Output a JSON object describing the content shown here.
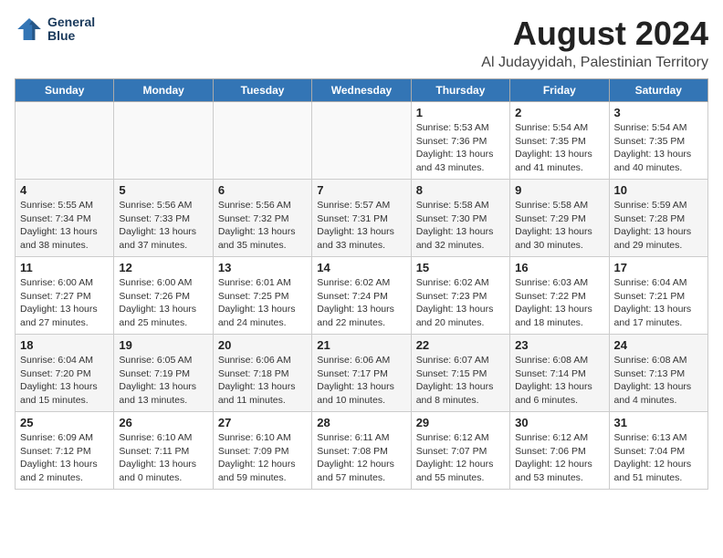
{
  "header": {
    "logo_line1": "General",
    "logo_line2": "Blue",
    "main_title": "August 2024",
    "subtitle": "Al Judayyidah, Palestinian Territory"
  },
  "calendar": {
    "weekdays": [
      "Sunday",
      "Monday",
      "Tuesday",
      "Wednesday",
      "Thursday",
      "Friday",
      "Saturday"
    ],
    "weeks": [
      [
        {
          "day": "",
          "info": ""
        },
        {
          "day": "",
          "info": ""
        },
        {
          "day": "",
          "info": ""
        },
        {
          "day": "",
          "info": ""
        },
        {
          "day": "1",
          "info": "Sunrise: 5:53 AM\nSunset: 7:36 PM\nDaylight: 13 hours\nand 43 minutes."
        },
        {
          "day": "2",
          "info": "Sunrise: 5:54 AM\nSunset: 7:35 PM\nDaylight: 13 hours\nand 41 minutes."
        },
        {
          "day": "3",
          "info": "Sunrise: 5:54 AM\nSunset: 7:35 PM\nDaylight: 13 hours\nand 40 minutes."
        }
      ],
      [
        {
          "day": "4",
          "info": "Sunrise: 5:55 AM\nSunset: 7:34 PM\nDaylight: 13 hours\nand 38 minutes."
        },
        {
          "day": "5",
          "info": "Sunrise: 5:56 AM\nSunset: 7:33 PM\nDaylight: 13 hours\nand 37 minutes."
        },
        {
          "day": "6",
          "info": "Sunrise: 5:56 AM\nSunset: 7:32 PM\nDaylight: 13 hours\nand 35 minutes."
        },
        {
          "day": "7",
          "info": "Sunrise: 5:57 AM\nSunset: 7:31 PM\nDaylight: 13 hours\nand 33 minutes."
        },
        {
          "day": "8",
          "info": "Sunrise: 5:58 AM\nSunset: 7:30 PM\nDaylight: 13 hours\nand 32 minutes."
        },
        {
          "day": "9",
          "info": "Sunrise: 5:58 AM\nSunset: 7:29 PM\nDaylight: 13 hours\nand 30 minutes."
        },
        {
          "day": "10",
          "info": "Sunrise: 5:59 AM\nSunset: 7:28 PM\nDaylight: 13 hours\nand 29 minutes."
        }
      ],
      [
        {
          "day": "11",
          "info": "Sunrise: 6:00 AM\nSunset: 7:27 PM\nDaylight: 13 hours\nand 27 minutes."
        },
        {
          "day": "12",
          "info": "Sunrise: 6:00 AM\nSunset: 7:26 PM\nDaylight: 13 hours\nand 25 minutes."
        },
        {
          "day": "13",
          "info": "Sunrise: 6:01 AM\nSunset: 7:25 PM\nDaylight: 13 hours\nand 24 minutes."
        },
        {
          "day": "14",
          "info": "Sunrise: 6:02 AM\nSunset: 7:24 PM\nDaylight: 13 hours\nand 22 minutes."
        },
        {
          "day": "15",
          "info": "Sunrise: 6:02 AM\nSunset: 7:23 PM\nDaylight: 13 hours\nand 20 minutes."
        },
        {
          "day": "16",
          "info": "Sunrise: 6:03 AM\nSunset: 7:22 PM\nDaylight: 13 hours\nand 18 minutes."
        },
        {
          "day": "17",
          "info": "Sunrise: 6:04 AM\nSunset: 7:21 PM\nDaylight: 13 hours\nand 17 minutes."
        }
      ],
      [
        {
          "day": "18",
          "info": "Sunrise: 6:04 AM\nSunset: 7:20 PM\nDaylight: 13 hours\nand 15 minutes."
        },
        {
          "day": "19",
          "info": "Sunrise: 6:05 AM\nSunset: 7:19 PM\nDaylight: 13 hours\nand 13 minutes."
        },
        {
          "day": "20",
          "info": "Sunrise: 6:06 AM\nSunset: 7:18 PM\nDaylight: 13 hours\nand 11 minutes."
        },
        {
          "day": "21",
          "info": "Sunrise: 6:06 AM\nSunset: 7:17 PM\nDaylight: 13 hours\nand 10 minutes."
        },
        {
          "day": "22",
          "info": "Sunrise: 6:07 AM\nSunset: 7:15 PM\nDaylight: 13 hours\nand 8 minutes."
        },
        {
          "day": "23",
          "info": "Sunrise: 6:08 AM\nSunset: 7:14 PM\nDaylight: 13 hours\nand 6 minutes."
        },
        {
          "day": "24",
          "info": "Sunrise: 6:08 AM\nSunset: 7:13 PM\nDaylight: 13 hours\nand 4 minutes."
        }
      ],
      [
        {
          "day": "25",
          "info": "Sunrise: 6:09 AM\nSunset: 7:12 PM\nDaylight: 13 hours\nand 2 minutes."
        },
        {
          "day": "26",
          "info": "Sunrise: 6:10 AM\nSunset: 7:11 PM\nDaylight: 13 hours\nand 0 minutes."
        },
        {
          "day": "27",
          "info": "Sunrise: 6:10 AM\nSunset: 7:09 PM\nDaylight: 12 hours\nand 59 minutes."
        },
        {
          "day": "28",
          "info": "Sunrise: 6:11 AM\nSunset: 7:08 PM\nDaylight: 12 hours\nand 57 minutes."
        },
        {
          "day": "29",
          "info": "Sunrise: 6:12 AM\nSunset: 7:07 PM\nDaylight: 12 hours\nand 55 minutes."
        },
        {
          "day": "30",
          "info": "Sunrise: 6:12 AM\nSunset: 7:06 PM\nDaylight: 12 hours\nand 53 minutes."
        },
        {
          "day": "31",
          "info": "Sunrise: 6:13 AM\nSunset: 7:04 PM\nDaylight: 12 hours\nand 51 minutes."
        }
      ]
    ]
  }
}
